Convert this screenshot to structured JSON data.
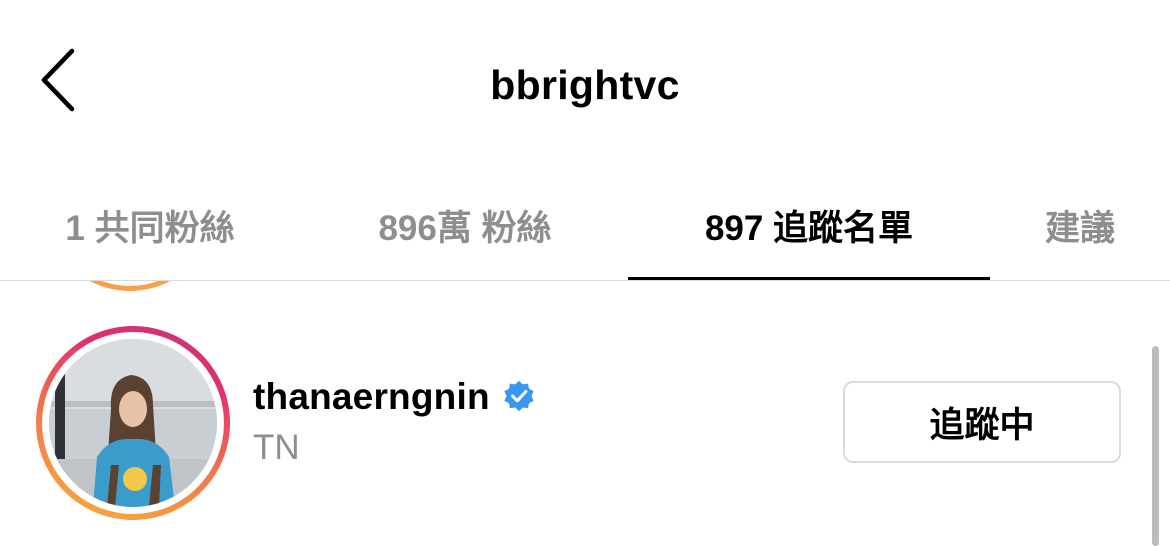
{
  "header": {
    "title": "bbright​vc",
    "back_icon": "chevron-left-icon"
  },
  "tabs": [
    {
      "label": "1 共同粉絲",
      "active": false
    },
    {
      "label": "896萬 粉絲",
      "active": false
    },
    {
      "label": "897 追蹤名單",
      "active": true
    },
    {
      "label": "建議",
      "active": false
    }
  ],
  "list": {
    "rows": [
      {
        "username": "thanaerngnin",
        "verified": true,
        "full_name": "TN",
        "button_label": "追蹤中"
      }
    ]
  },
  "colors": {
    "verified_blue": "#3897f0",
    "muted_text": "#8e8e8e",
    "divider": "#dbdbdb"
  }
}
